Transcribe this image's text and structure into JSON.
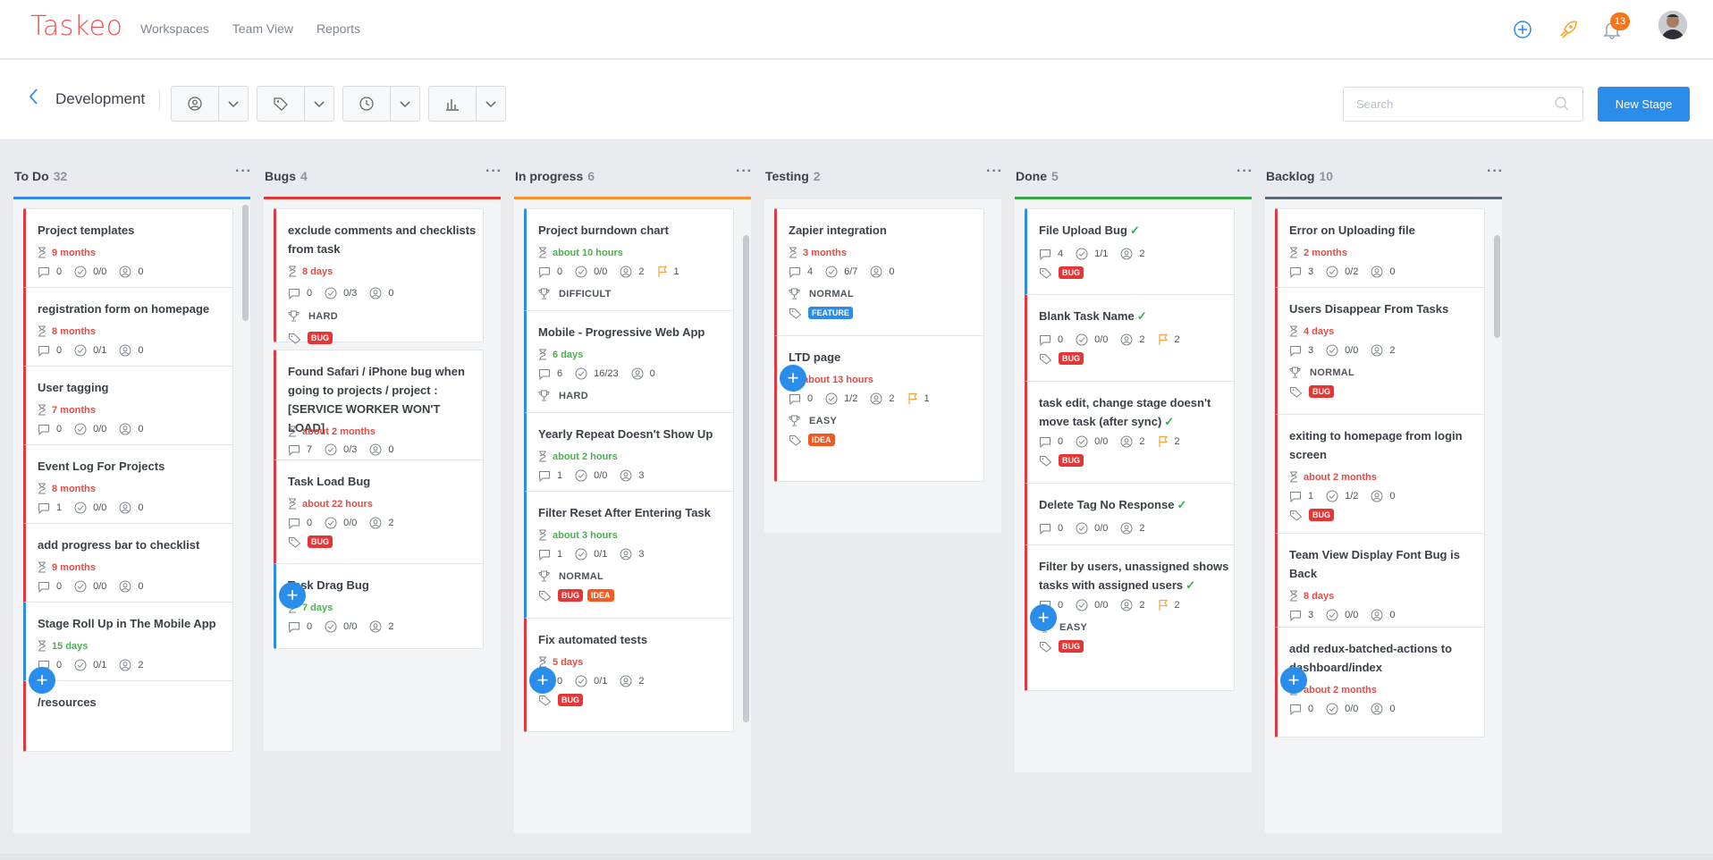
{
  "app": {
    "logo": "Taskeo",
    "nav": [
      "Workspaces",
      "Team View",
      "Reports"
    ],
    "notifications": "13"
  },
  "project": {
    "title": "Development",
    "search_placeholder": "Search",
    "new_stage_label": "New Stage"
  },
  "columns": [
    {
      "name": "To Do",
      "count": "32",
      "color": "#2f8de8",
      "cards": [
        {
          "title": "Project templates",
          "duration": "9 months",
          "comments": "0",
          "checks": "0/0",
          "users": "0"
        },
        {
          "title": "registration form on homepage",
          "duration": "8 months",
          "comments": "0",
          "checks": "0/1",
          "users": "0"
        },
        {
          "title": "User tagging",
          "duration": "7 months",
          "comments": "0",
          "checks": "0/0",
          "users": "0"
        },
        {
          "title": "Event Log For Projects",
          "duration": "8 months",
          "comments": "1",
          "checks": "0/0",
          "users": "0"
        },
        {
          "title": "add progress bar to checklist",
          "duration": "9 months",
          "comments": "0",
          "checks": "0/0",
          "users": "0"
        },
        {
          "title": "Stage Roll Up in The Mobile App",
          "duration": "15 days",
          "comments": "0",
          "checks": "0/1",
          "users": "2"
        },
        {
          "title": "/resources"
        }
      ]
    },
    {
      "name": "Bugs",
      "count": "4",
      "color": "#e63535",
      "cards": [
        {
          "title": "exclude comments and checklists from task",
          "duration": "8 days",
          "comments": "0",
          "checks": "0/3",
          "users": "0",
          "difficulty": "HARD",
          "tags": [
            "BUG"
          ]
        },
        {
          "title": "Found Safari / iPhone bug when going to projects / project : [SERVICE WORKER WON'T LOAD]",
          "duration": "about 2 months",
          "comments": "7",
          "checks": "0/3",
          "users": "0"
        },
        {
          "title": "Task Load Bug",
          "duration": "about 22 hours",
          "comments": "0",
          "checks": "0/0",
          "users": "2",
          "tags": [
            "BUG"
          ]
        },
        {
          "title": "Task Drag Bug",
          "duration": "7 days",
          "comments": "0",
          "checks": "0/0",
          "users": "2"
        }
      ]
    },
    {
      "name": "In progress",
      "count": "6",
      "color": "#f5922c",
      "cards": [
        {
          "title": "Project burndown chart",
          "duration": "about 10 hours",
          "comments": "0",
          "checks": "0/0",
          "users": "2",
          "flags": "1",
          "difficulty": "DIFFICULT"
        },
        {
          "title": "Mobile - Progressive Web App",
          "duration": "6 days",
          "comments": "6",
          "checks": "16/23",
          "users": "0",
          "difficulty": "HARD"
        },
        {
          "title": "Yearly Repeat Doesn't Show Up",
          "duration": "about 2 hours",
          "comments": "1",
          "checks": "0/0",
          "users": "3"
        },
        {
          "title": "Filter Reset After Entering Task",
          "duration": "about 3 hours",
          "comments": "1",
          "checks": "0/1",
          "users": "3",
          "difficulty": "NORMAL",
          "tags": [
            "BUG",
            "IDEA"
          ]
        },
        {
          "title": "Fix automated tests",
          "duration": "5 days",
          "comments": "0",
          "checks": "0/1",
          "users": "2",
          "tags": [
            "BUG"
          ]
        }
      ]
    },
    {
      "name": "Testing",
      "count": "2",
      "color": "#e9ebee",
      "cards": [
        {
          "title": "Zapier integration",
          "duration": "3 months",
          "comments": "4",
          "checks": "6/7",
          "users": "0",
          "difficulty": "NORMAL",
          "tags": [
            "FEATURE"
          ]
        },
        {
          "title": "LTD page",
          "duration": "about 13 hours",
          "comments": "0",
          "checks": "1/2",
          "users": "2",
          "flags": "1",
          "difficulty": "EASY",
          "tags": [
            "IDEA"
          ]
        }
      ]
    },
    {
      "name": "Done",
      "count": "5",
      "color": "#33a845",
      "cards": [
        {
          "title": "File Upload Bug",
          "comments": "4",
          "checks": "1/1",
          "users": "2",
          "tags": [
            "BUG"
          ]
        },
        {
          "title": "Blank Task Name",
          "comments": "0",
          "checks": "0/0",
          "users": "2",
          "flags": "2",
          "tags": [
            "BUG"
          ]
        },
        {
          "title": "task edit, change stage doesn't move task (after sync)",
          "comments": "0",
          "checks": "0/0",
          "users": "2",
          "flags": "2",
          "tags": [
            "BUG"
          ]
        },
        {
          "title": "Delete Tag No Response",
          "comments": "0",
          "checks": "0/0",
          "users": "2"
        },
        {
          "title": "Filter by users, unassigned shows tasks with assigned users",
          "comments": "0",
          "checks": "0/0",
          "users": "2",
          "flags": "2",
          "difficulty": "EASY",
          "tags": [
            "BUG"
          ]
        }
      ]
    },
    {
      "name": "Backlog",
      "count": "10",
      "color": "#5f6a78",
      "cards": [
        {
          "title": "Error on Uploading file",
          "duration": "2 months",
          "comments": "3",
          "checks": "0/2",
          "users": "0"
        },
        {
          "title": "Users Disappear From Tasks",
          "duration": "4 days",
          "comments": "3",
          "checks": "0/0",
          "users": "2",
          "difficulty": "NORMAL",
          "tags": [
            "BUG"
          ]
        },
        {
          "title": "exiting to homepage from login screen",
          "duration": "about 2 months",
          "comments": "1",
          "checks": "1/2",
          "users": "0",
          "tags": [
            "BUG"
          ]
        },
        {
          "title": "Team View Display Font Bug is Back",
          "duration": "8 days",
          "comments": "3",
          "checks": "0/0",
          "users": "0"
        },
        {
          "title": "add redux-batched-actions to dashboard/index",
          "duration": "about 2 months",
          "comments": "0",
          "checks": "0/0",
          "users": "0"
        }
      ]
    }
  ]
}
